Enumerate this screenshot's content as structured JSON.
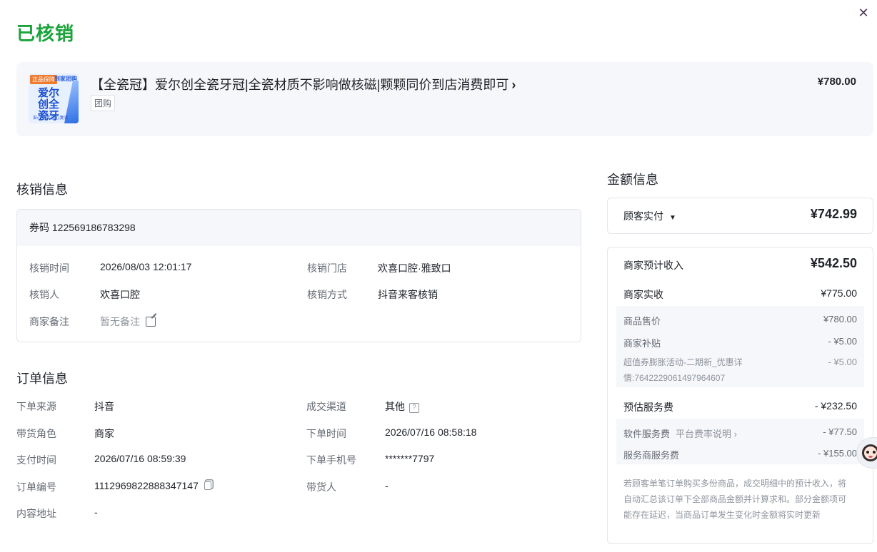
{
  "header": {
    "title": "已核销",
    "close_symbol": "✕"
  },
  "product": {
    "thumb_tag_left": "正品保障",
    "thumb_tag_right": "到家团购",
    "thumb_text": "爱尔创全瓷牙",
    "thumb_foot": "安心下单 放心复诊",
    "title": "【全瓷冠】爱尔创全瓷牙冠|全瓷材质不影响做核磁|颗颗同价到店消费即可",
    "chevron": "›",
    "type": "团购",
    "price": "¥780.00"
  },
  "verification": {
    "section_title": "核销信息",
    "coupon_label": "券码",
    "coupon_code": "122569186783298",
    "time_label": "核销时间",
    "time_value": "2026/08/03 12:01:17",
    "store_label": "核销门店",
    "store_value": "欢喜口腔·雅致口",
    "person_label": "核销人",
    "person_value": "欢喜口腔",
    "method_label": "核销方式",
    "method_value": "抖音来客核销",
    "remark_label": "商家备注",
    "remark_value": "暂无备注"
  },
  "order": {
    "section_title": "订单信息",
    "source_label": "下单来源",
    "source_value": "抖音",
    "channel_label": "成交渠道",
    "channel_value": "其他",
    "role_label": "带货角色",
    "role_value": "商家",
    "order_time_label": "下单时间",
    "order_time_value": "2026/07/16 08:58:18",
    "pay_time_label": "支付时间",
    "pay_time_value": "2026/07/16 08:59:39",
    "phone_label": "下单手机号",
    "phone_value": "*******7797",
    "number_label": "订单编号",
    "number_value": "1112969822888347147",
    "promoter_label": "带货人",
    "promoter_value": "-",
    "content_label": "内容地址",
    "content_value": "-"
  },
  "amount": {
    "section_title": "金额信息",
    "customer_paid_label": "顾客实付",
    "customer_paid_value": "¥742.99",
    "merchant_expected_label": "商家预计收入",
    "merchant_expected_value": "¥542.50",
    "merchant_actual_label": "商家实收",
    "merchant_actual_value": "¥775.00",
    "goods_price_label": "商品售价",
    "goods_price_value": "¥780.00",
    "subsidy_label": "商家补贴",
    "subsidy_value": "- ¥5.00",
    "promo_line1": "超值券膨胀活动-二期新_优惠详",
    "promo_line2": "情:7642229061497964607",
    "promo_value": "- ¥5.00",
    "service_fee_label": "预估服务费",
    "service_fee_value": "- ¥232.50",
    "software_fee_label": "软件服务费",
    "software_fee_link": "平台费率说明",
    "software_fee_value": "- ¥77.50",
    "provider_fee_label": "服务商服务费",
    "provider_fee_value": "- ¥155.00",
    "note": "若顾客单笔订单购买多份商品，成交明细中的预计收入，将自动汇总该订单下全部商品金额并计算求和。部分金额项可能存在延迟，当商品订单发生变化时金额将实时更新"
  },
  "colors": {
    "accent_green": "#1aa33b",
    "text": "#1f2329",
    "muted": "#8f959e",
    "panel_bg": "#f5f7fa"
  }
}
